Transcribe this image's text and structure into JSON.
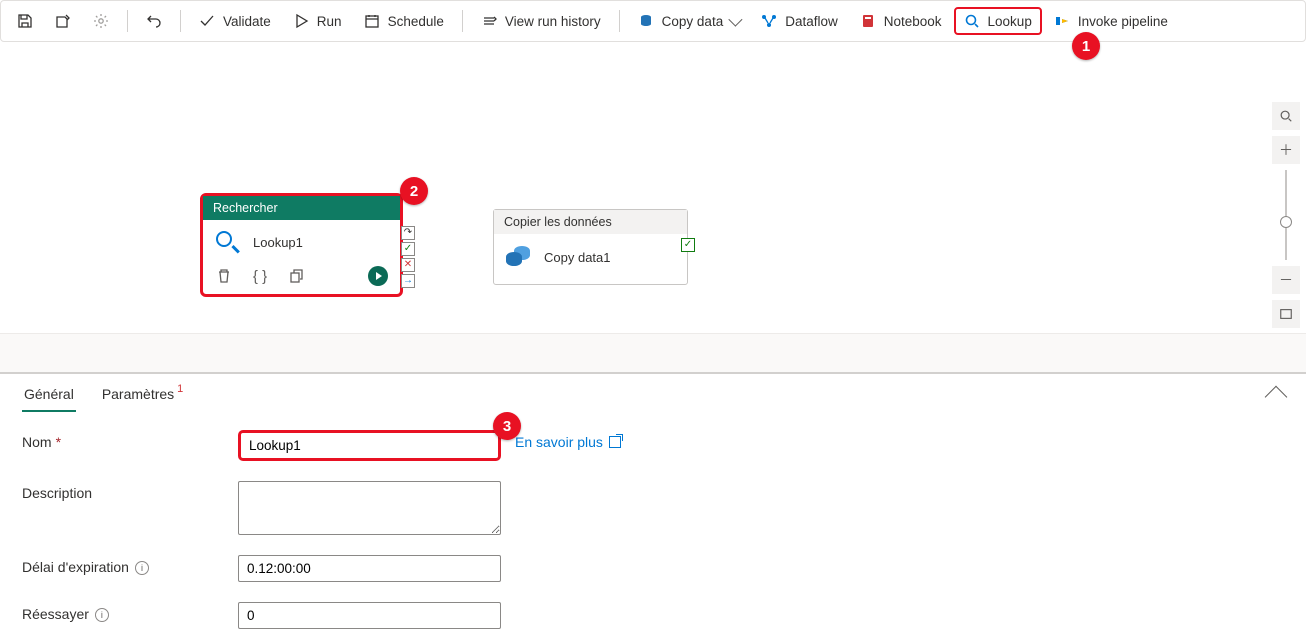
{
  "toolbar": {
    "validate": "Validate",
    "run": "Run",
    "schedule": "Schedule",
    "view_history": "View run history",
    "copy_data": "Copy data",
    "dataflow": "Dataflow",
    "notebook": "Notebook",
    "lookup": "Lookup",
    "invoke": "Invoke pipeline"
  },
  "callouts": {
    "b1": "1",
    "b2": "2",
    "b3": "3"
  },
  "node_lookup": {
    "header": "Rechercher",
    "title": "Lookup1"
  },
  "node_copy": {
    "header": "Copier les données",
    "title": "Copy data1"
  },
  "tabs": {
    "general": "Général",
    "parametres": "Paramètres",
    "sup": "1"
  },
  "form": {
    "nom_label": "Nom",
    "nom_value": "Lookup1",
    "learn_more": "En savoir plus",
    "desc_label": "Description",
    "desc_value": "",
    "timeout_label": "Délai d'expiration",
    "timeout_value": "0.12:00:00",
    "retry_label": "Réessayer",
    "retry_value": "0"
  }
}
